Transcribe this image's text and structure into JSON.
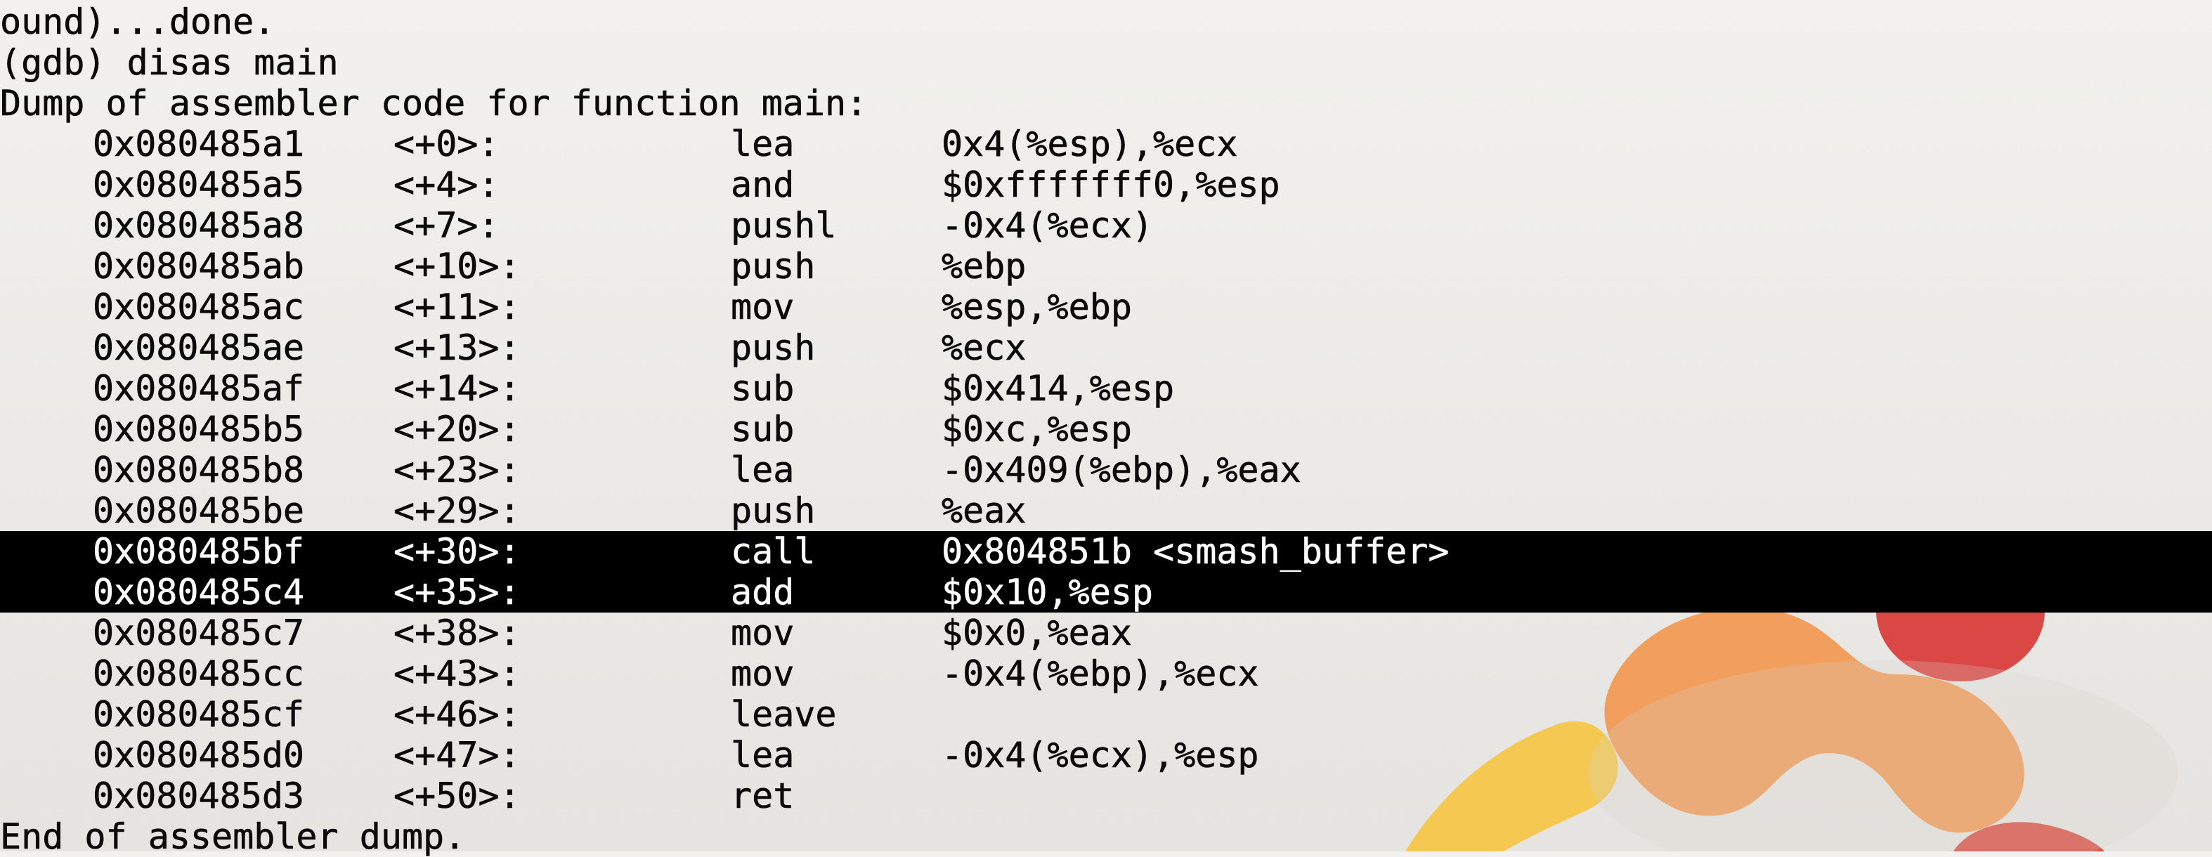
{
  "header_lines": [
    "ound)...done.",
    "(gdb) disas main",
    "Dump of assembler code for function main:"
  ],
  "instructions": [
    {
      "address": "0x080485a1",
      "offset": "<+0>:",
      "mnemonic": "lea",
      "operands": "0x4(%esp),%ecx"
    },
    {
      "address": "0x080485a5",
      "offset": "<+4>:",
      "mnemonic": "and",
      "operands": "$0xfffffff0,%esp"
    },
    {
      "address": "0x080485a8",
      "offset": "<+7>:",
      "mnemonic": "pushl",
      "operands": "-0x4(%ecx)"
    },
    {
      "address": "0x080485ab",
      "offset": "<+10>:",
      "mnemonic": "push",
      "operands": "%ebp"
    },
    {
      "address": "0x080485ac",
      "offset": "<+11>:",
      "mnemonic": "mov",
      "operands": "%esp,%ebp"
    },
    {
      "address": "0x080485ae",
      "offset": "<+13>:",
      "mnemonic": "push",
      "operands": "%ecx"
    },
    {
      "address": "0x080485af",
      "offset": "<+14>:",
      "mnemonic": "sub",
      "operands": "$0x414,%esp"
    },
    {
      "address": "0x080485b5",
      "offset": "<+20>:",
      "mnemonic": "sub",
      "operands": "$0xc,%esp"
    },
    {
      "address": "0x080485b8",
      "offset": "<+23>:",
      "mnemonic": "lea",
      "operands": "-0x409(%ebp),%eax"
    },
    {
      "address": "0x080485be",
      "offset": "<+29>:",
      "mnemonic": "push",
      "operands": "%eax"
    },
    {
      "address": "0x080485bf",
      "offset": "<+30>:",
      "mnemonic": "call",
      "operands": "0x804851b <smash_buffer>",
      "highlighted": true
    },
    {
      "address": "0x080485c4",
      "offset": "<+35>:",
      "mnemonic": "add",
      "operands": "$0x10,%esp",
      "highlighted": true
    },
    {
      "address": "0x080485c7",
      "offset": "<+38>:",
      "mnemonic": "mov",
      "operands": "$0x0,%eax"
    },
    {
      "address": "0x080485cc",
      "offset": "<+43>:",
      "mnemonic": "mov",
      "operands": "-0x4(%ebp),%ecx"
    },
    {
      "address": "0x080485cf",
      "offset": "<+46>:",
      "mnemonic": "leave",
      "operands": ""
    },
    {
      "address": "0x080485d0",
      "offset": "<+47>:",
      "mnemonic": "lea",
      "operands": "-0x4(%ecx),%esp"
    },
    {
      "address": "0x080485d3",
      "offset": "<+50>:",
      "mnemonic": "ret",
      "operands": ""
    }
  ],
  "footer_line": "End of assembler dump.",
  "colors": {
    "text": "#0a0a0a",
    "selection_background": "#000000",
    "selection_text": "#ffffff",
    "wallpaper_background": "#eeede9"
  }
}
